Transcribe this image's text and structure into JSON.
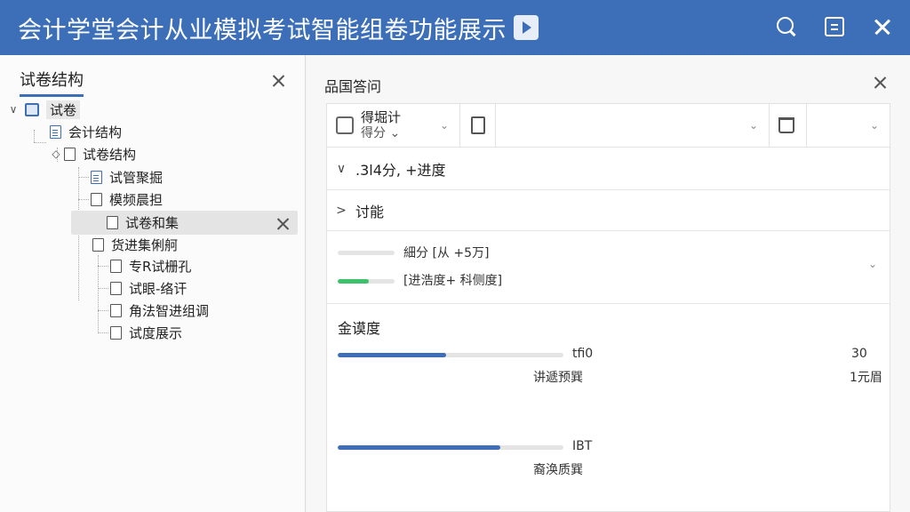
{
  "app": {
    "title": "会计学堂会计从业模拟考试智能组卷功能展示"
  },
  "left": {
    "title": "试卷结构",
    "tree": [
      {
        "label": "试卷",
        "level": 0
      },
      {
        "label": "会计结构",
        "level": 1
      },
      {
        "label": "试卷结构",
        "level": 2
      },
      {
        "label": "试管聚掘",
        "level": 3
      },
      {
        "label": "模频晨担",
        "level": 3
      },
      {
        "label": "试卷和集",
        "level": 3
      },
      {
        "label": "货进集俐舸",
        "level": 3
      },
      {
        "label": "专R试栅孔",
        "level": 4
      },
      {
        "label": "试眼-络讦",
        "level": 4
      },
      {
        "label": "角法智进组调",
        "level": 4
      },
      {
        "label": "试度展示",
        "level": 4
      }
    ]
  },
  "right": {
    "title": "品国答问",
    "toolbar": {
      "select1_label": "得堀计",
      "select1_sub": "得分"
    },
    "section1": ".3l4分, +进度",
    "section2": "讨能",
    "progress_rows": [
      {
        "label": "細分 [从    +5万]",
        "value": 0.0,
        "color": "#e4e4e4"
      },
      {
        "label": "[进浩度+ 科侧度]",
        "value": 0.55,
        "color": "#3cc26a"
      }
    ],
    "summary": {
      "title": "金谟度",
      "bars": [
        {
          "left_label": "tfi0",
          "sub_label": "讲遞预巽",
          "right_value": "30",
          "right_sub": "1元眉",
          "value": 0.48,
          "color": "#3c6fb8"
        },
        {
          "left_label": "IBT",
          "sub_label": "裔涣质巽",
          "value": 0.72,
          "color": "#3c6fb8"
        }
      ]
    }
  }
}
